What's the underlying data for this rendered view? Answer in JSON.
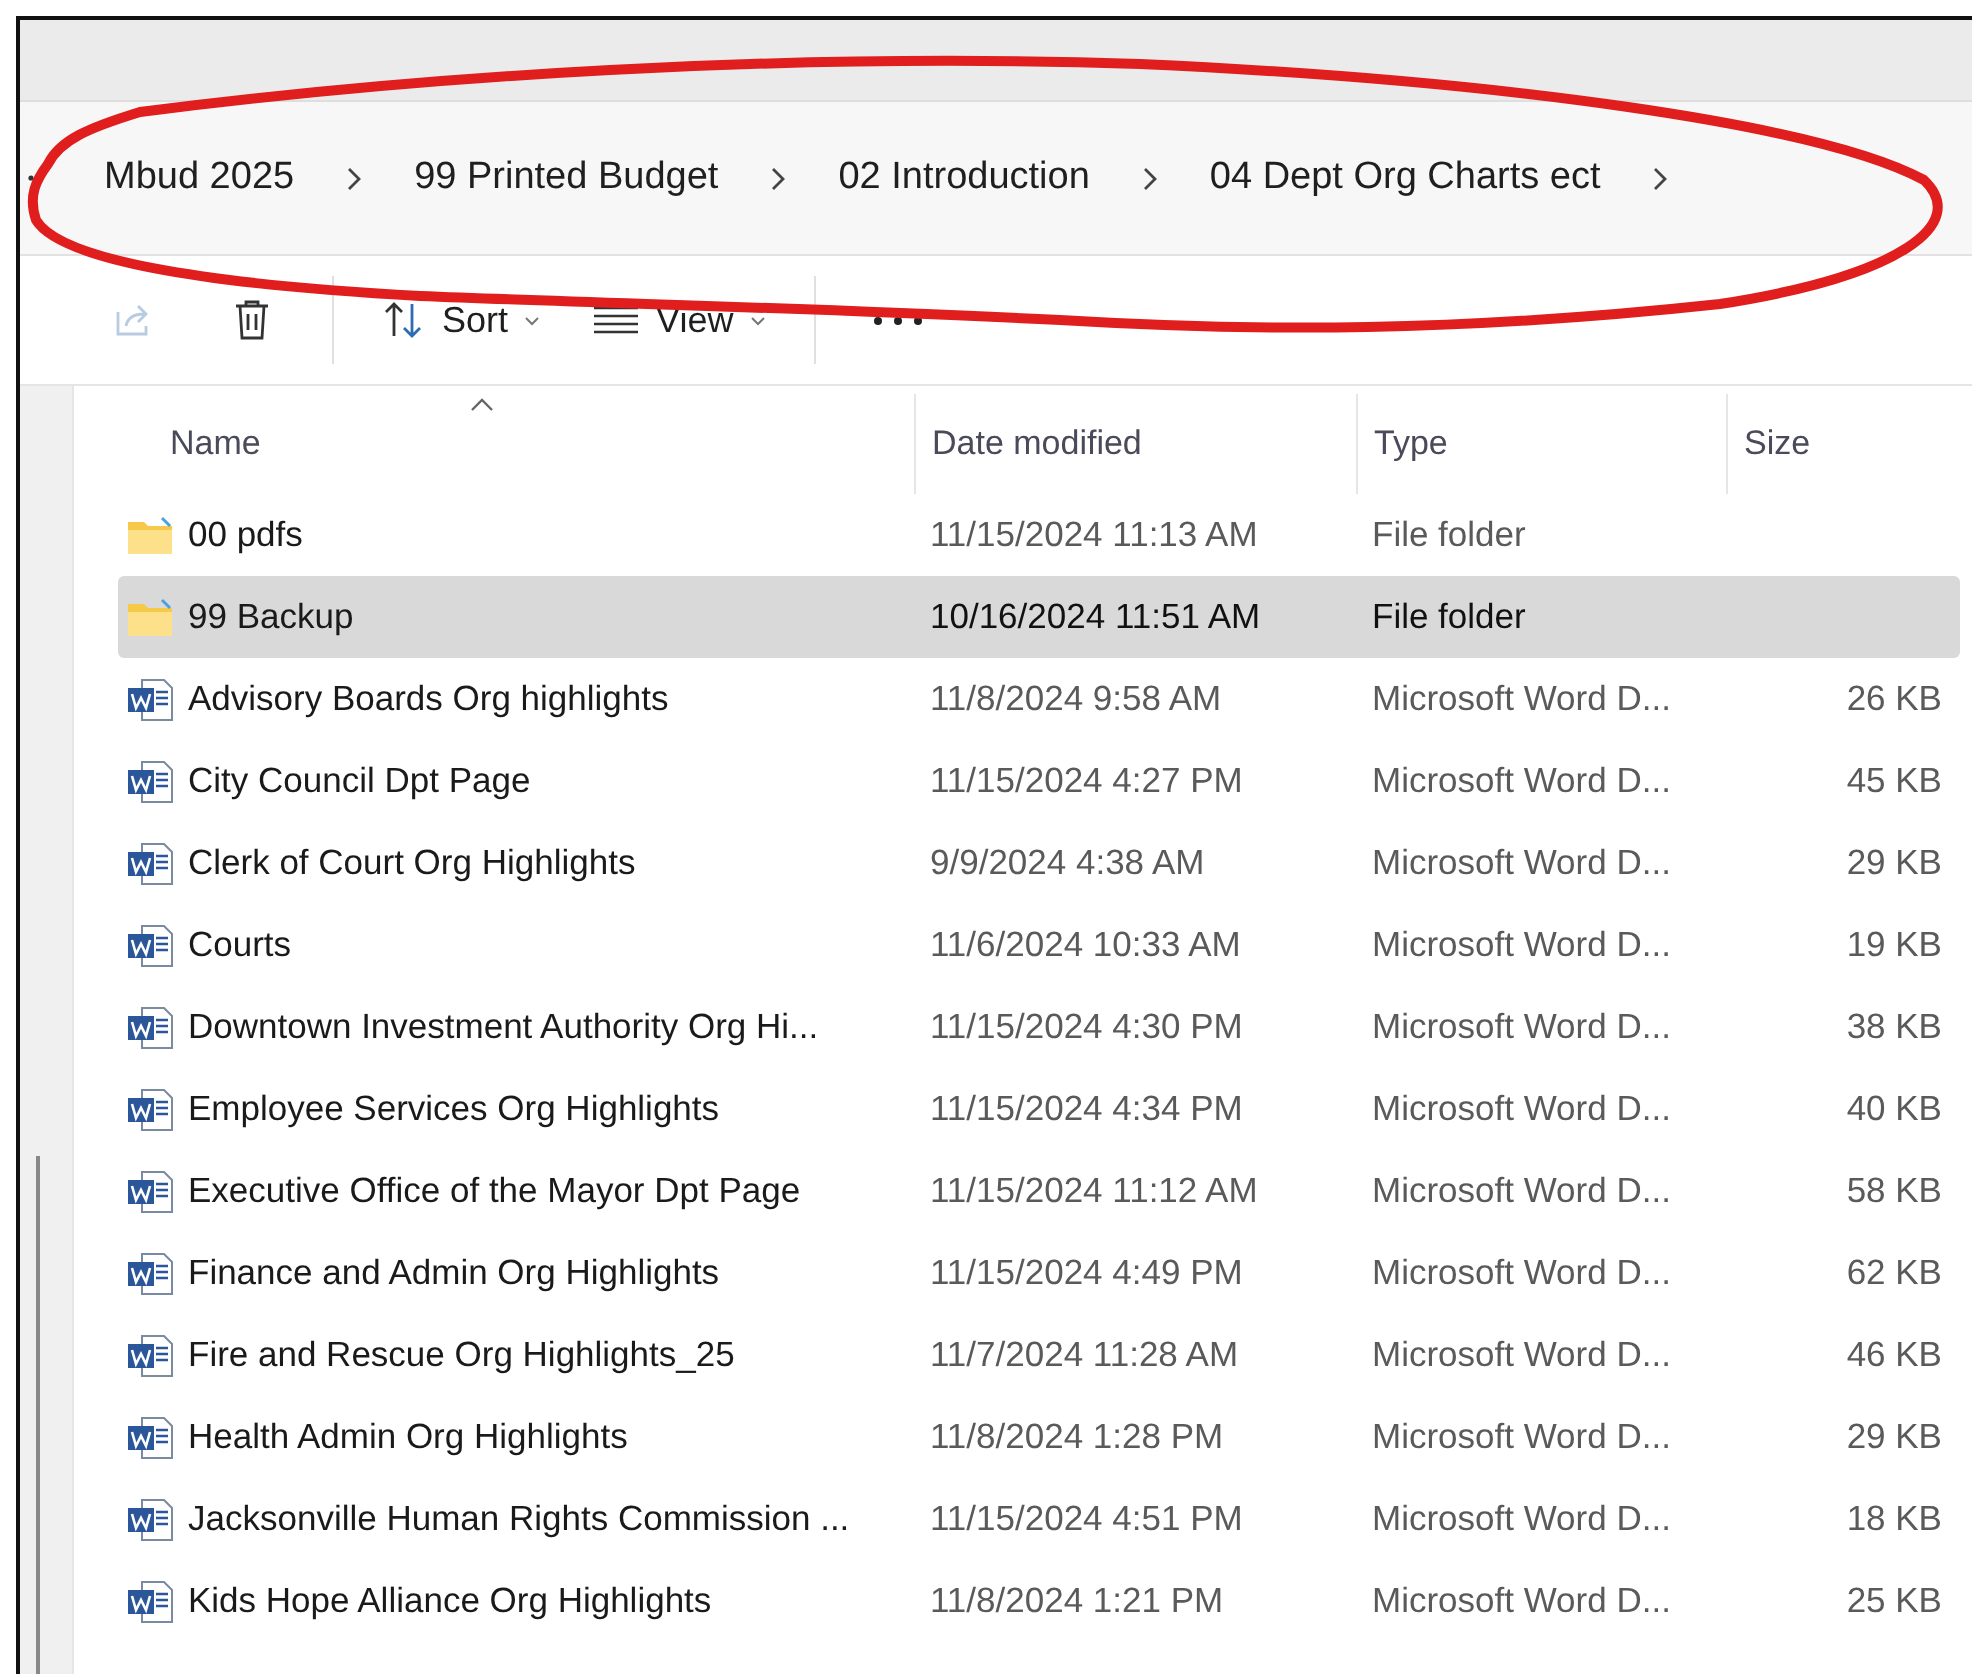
{
  "breadcrumbs": [
    "Mbud 2025",
    "99 Printed Budget",
    "02 Introduction",
    "04 Dept Org Charts ect"
  ],
  "toolbar": {
    "share": {
      "disabled": true
    },
    "sort": "Sort",
    "view": "View"
  },
  "columns": [
    "Name",
    "Date modified",
    "Type",
    "Size"
  ],
  "rows": [
    {
      "kind": "folder",
      "name": "00 pdfs",
      "date": "11/15/2024 11:13 AM",
      "type": "File folder",
      "selected": false
    },
    {
      "kind": "folder",
      "name": "99 Backup",
      "date": "10/16/2024 11:51 AM",
      "type": "File folder",
      "selected": true
    },
    {
      "kind": "word",
      "name": "Advisory Boards Org highlights",
      "date": "11/8/2024 9:58 AM",
      "type": "Microsoft Word D...",
      "size": "26 KB",
      "selected": false
    },
    {
      "kind": "word",
      "name": "City Council Dpt Page",
      "date": "11/15/2024 4:27 PM",
      "type": "Microsoft Word D...",
      "size": "45 KB",
      "selected": false
    },
    {
      "kind": "word",
      "name": "Clerk of Court Org Highlights",
      "date": "9/9/2024 4:38 AM",
      "type": "Microsoft Word D...",
      "size": "29 KB",
      "selected": false
    },
    {
      "kind": "word",
      "name": "Courts",
      "date": "11/6/2024 10:33 AM",
      "type": "Microsoft Word D...",
      "size": "19 KB",
      "selected": false
    },
    {
      "kind": "word",
      "name": "Downtown Investment Authority Org Hi...",
      "date": "11/15/2024 4:30 PM",
      "type": "Microsoft Word D...",
      "size": "38 KB",
      "selected": false
    },
    {
      "kind": "word",
      "name": "Employee Services Org Highlights",
      "date": "11/15/2024 4:34 PM",
      "type": "Microsoft Word D...",
      "size": "40 KB",
      "selected": false
    },
    {
      "kind": "word",
      "name": "Executive Office of the Mayor Dpt Page",
      "date": "11/15/2024 11:12 AM",
      "type": "Microsoft Word D...",
      "size": "58 KB",
      "selected": false
    },
    {
      "kind": "word",
      "name": "Finance and Admin Org Highlights",
      "date": "11/15/2024 4:49 PM",
      "type": "Microsoft Word D...",
      "size": "62 KB",
      "selected": false
    },
    {
      "kind": "word",
      "name": "Fire and Rescue Org Highlights_25",
      "date": "11/7/2024 11:28 AM",
      "type": "Microsoft Word D...",
      "size": "46 KB",
      "selected": false
    },
    {
      "kind": "word",
      "name": "Health Admin Org Highlights",
      "date": "11/8/2024 1:28 PM",
      "type": "Microsoft Word D...",
      "size": "29 KB",
      "selected": false
    },
    {
      "kind": "word",
      "name": "Jacksonville Human Rights Commission ...",
      "date": "11/15/2024 4:51 PM",
      "type": "Microsoft Word D...",
      "size": "18 KB",
      "selected": false
    },
    {
      "kind": "word",
      "name": "Kids Hope Alliance Org Highlights",
      "date": "11/8/2024 1:21 PM",
      "type": "Microsoft Word D...",
      "size": "25 KB",
      "selected": false
    }
  ]
}
